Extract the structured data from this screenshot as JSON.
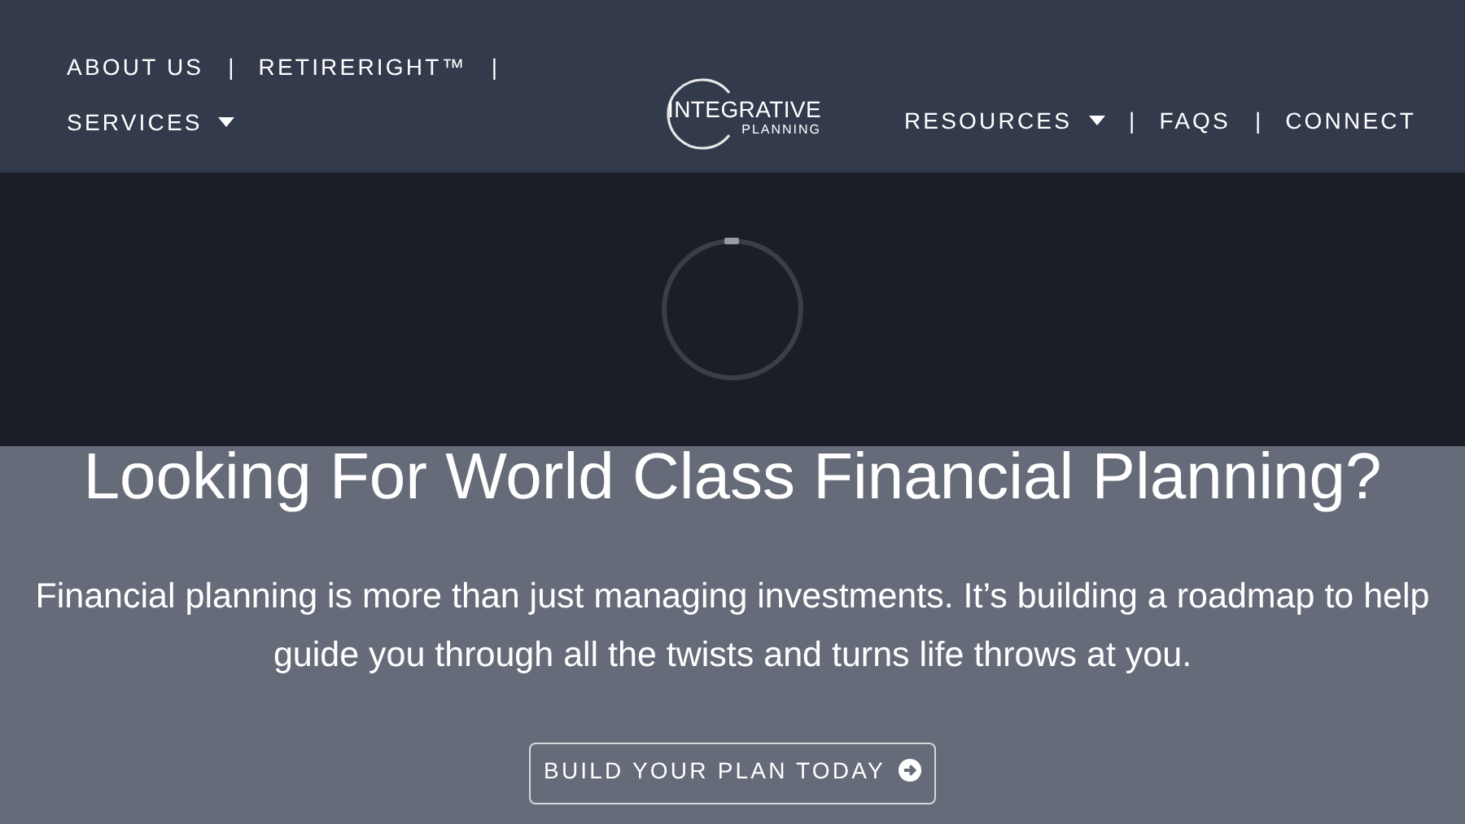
{
  "nav_left": [
    {
      "kind": "link",
      "label": "ABOUT US",
      "dropdown": false
    },
    {
      "kind": "separator",
      "label": "|"
    },
    {
      "kind": "link",
      "label": "RETIRERIGHT™",
      "dropdown": false
    },
    {
      "kind": "separator",
      "label": "|"
    },
    {
      "kind": "link",
      "label": "SERVICES",
      "dropdown": true
    }
  ],
  "logo": {
    "name": "INTEGRATIVE",
    "sub": "PLANNING"
  },
  "nav_right": [
    {
      "kind": "link",
      "label": "RESOURCES",
      "dropdown": true
    },
    {
      "kind": "separator",
      "label": "|"
    },
    {
      "kind": "link",
      "label": "FAQS",
      "dropdown": false
    },
    {
      "kind": "separator",
      "label": "|"
    },
    {
      "kind": "link",
      "label": "CONNECT",
      "dropdown": false
    }
  ],
  "hero": {
    "title": "Looking For World Class Financial Planning?",
    "text": "Financial planning is more than just managing investments. It’s building a roadmap to help guide you through all the twists and turns life throws at you.",
    "button": "BUILD YOUR PLAN TODAY"
  }
}
